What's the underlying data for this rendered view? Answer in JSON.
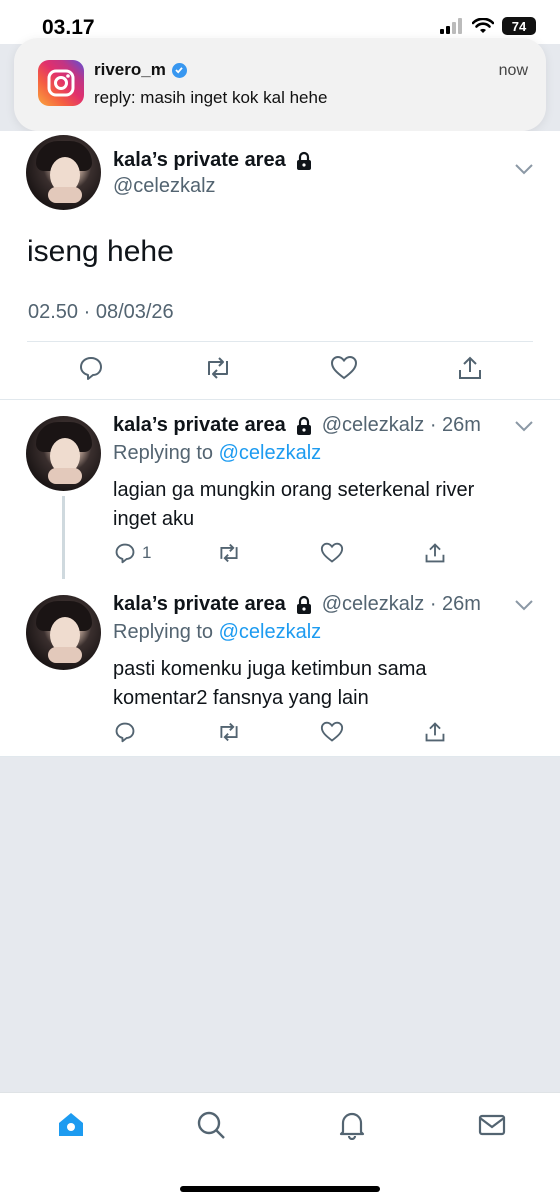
{
  "status_bar": {
    "time": "03.17",
    "battery": "74"
  },
  "notification": {
    "app_icon": "instagram-icon",
    "sender": "rivero_m",
    "message": "reply: masih inget kok kal hehe",
    "time": "now"
  },
  "main_tweet": {
    "name": "kala’s private area",
    "handle": "@celezkalz",
    "text": "iseng hehe",
    "datetime": "02.50 · 08/03/26"
  },
  "replies": [
    {
      "name": "kala’s private area",
      "meta": "@celezkalz · 26m",
      "replying_label": "Replying to",
      "replying_to": "@celezkalz",
      "text": "lagian ga mungkin orang seterkenal river inget aku",
      "reply_count": "1"
    },
    {
      "name": "kala’s private area",
      "meta": "@celezkalz · 26m",
      "replying_label": "Replying to",
      "replying_to": "@celezkalz",
      "text": "pasti komenku juga ketimbun sama komentar2 fansnya yang lain",
      "reply_count": ""
    }
  ],
  "tab_bar": [
    "home-icon",
    "search-icon",
    "bell-icon",
    "mail-icon"
  ],
  "colors": {
    "accent": "#1d9bf0",
    "muted": "#536471",
    "background": "#e6e9ee"
  }
}
